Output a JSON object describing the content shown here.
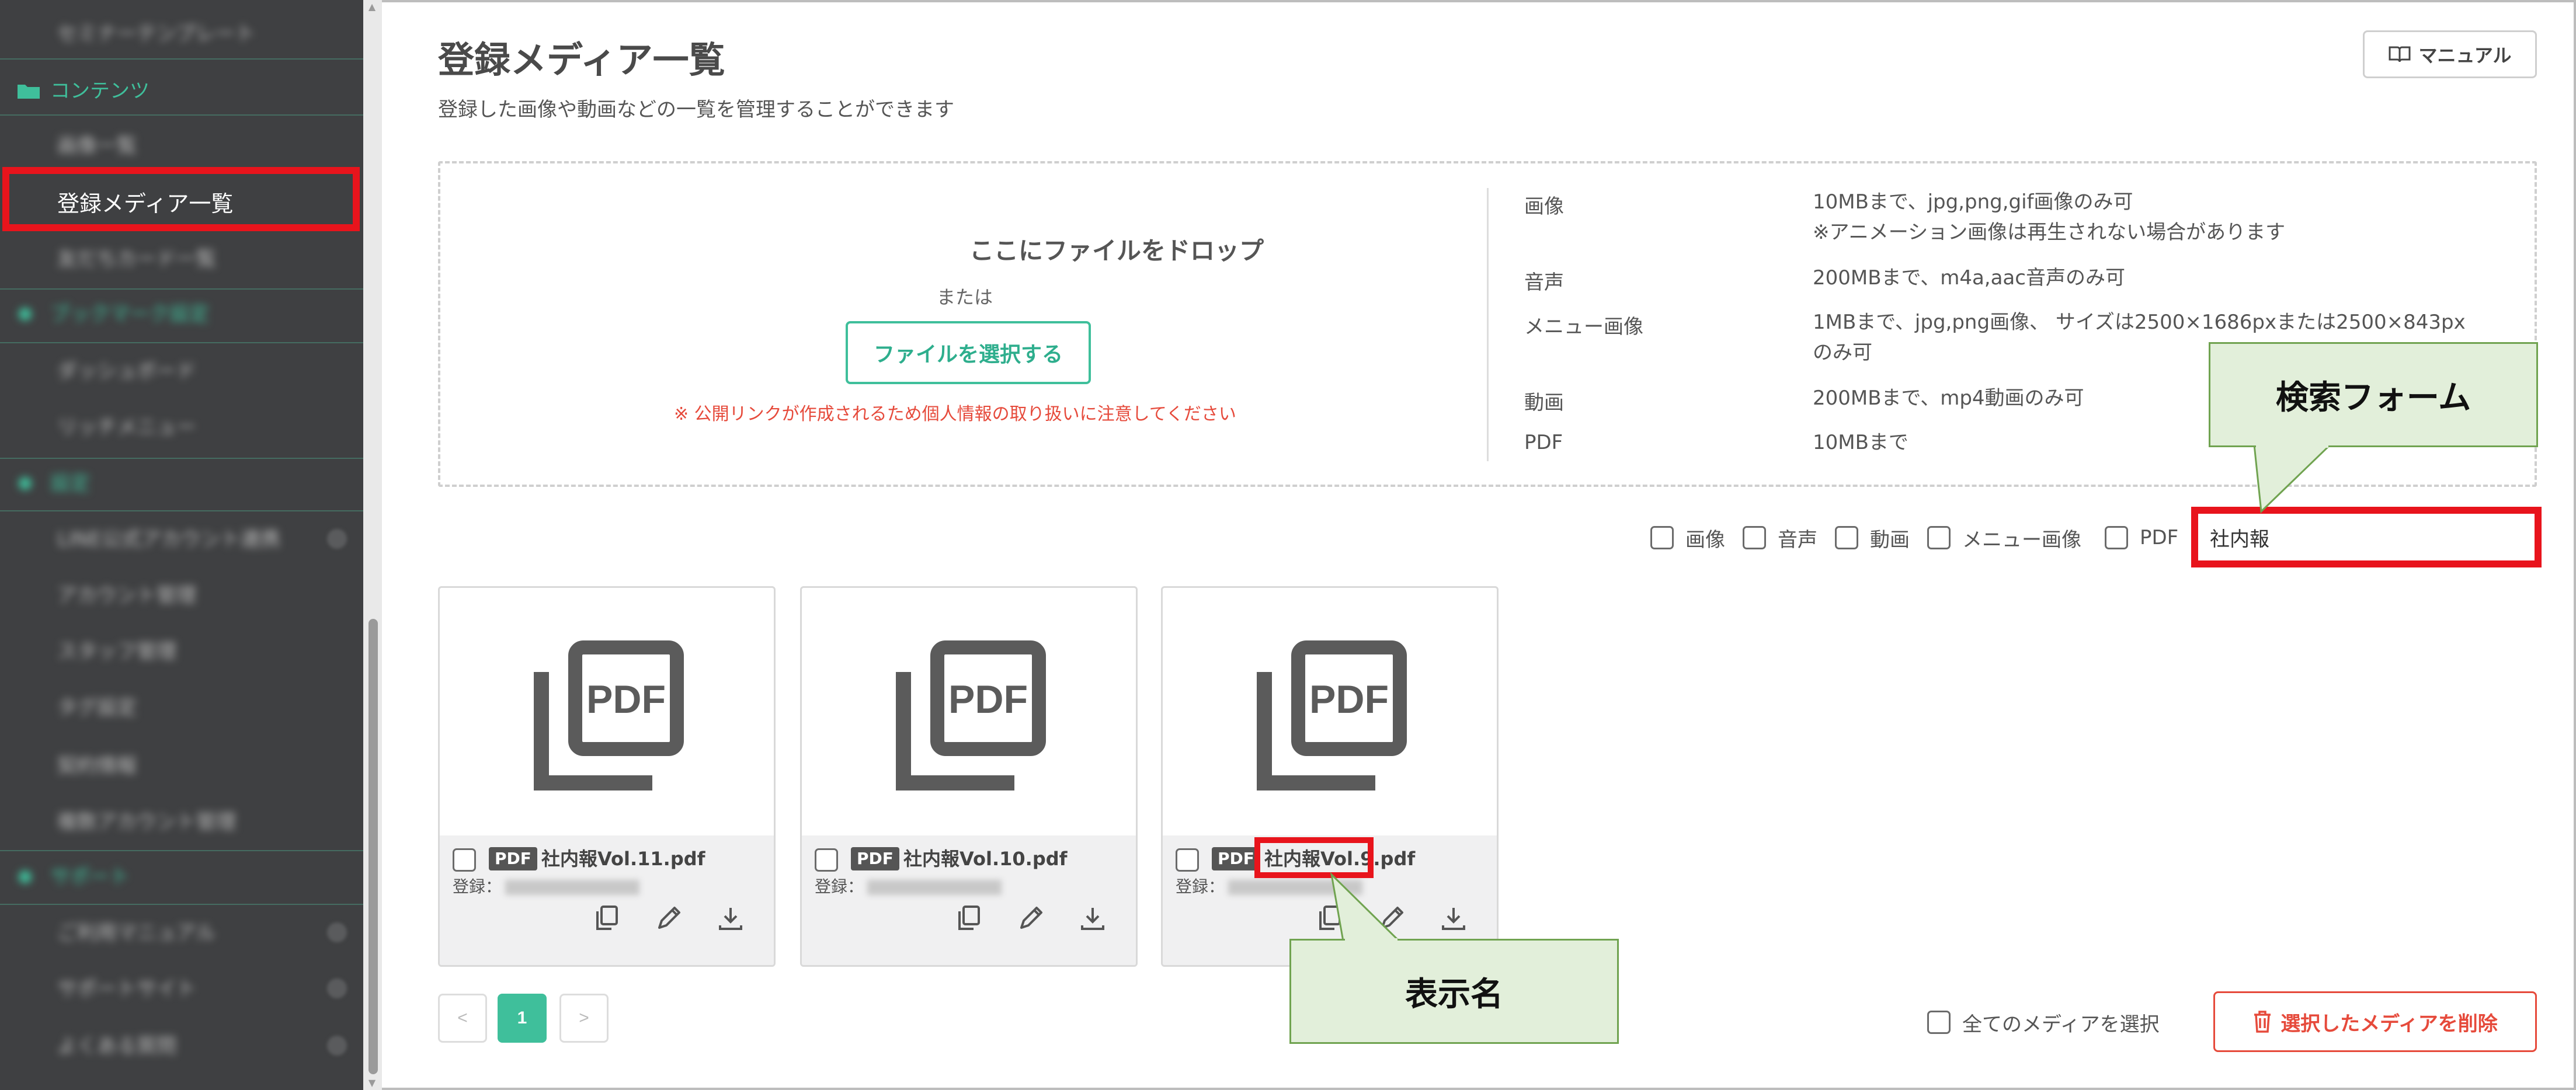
{
  "sidebar": {
    "top_item_blurred": "セミナーテンプレート",
    "section_contents": "コンテンツ",
    "item_blurred_1": "画像一覧",
    "active_item": "登録メディア一覧",
    "item_blurred_2": "友だちカード一覧",
    "section_blurred_1": "ブックマーク設定",
    "item_blurred_3": "ダッシュボード",
    "item_blurred_4": "リッチメニュー",
    "section_blurred_2": "設定",
    "item_blurred_5": "LINE公式アカウント連携",
    "item_blurred_6": "アカウント管理",
    "item_blurred_7": "スタッフ管理",
    "item_blurred_8": "タグ設定",
    "item_blurred_9": "契約情報",
    "item_blurred_10": "複数アカウント管理",
    "section_blurred_3": "サポート",
    "item_blurred_11": "ご利用マニュアル",
    "item_blurred_12": "サポートサイト",
    "item_blurred_13": "よくある質問"
  },
  "header": {
    "title": "登録メディア一覧",
    "subtitle": "登録した画像や動画などの一覧を管理することができます",
    "manual_button": "マニュアル"
  },
  "dropzone": {
    "title": "ここにファイルをドロップ",
    "or": "または",
    "select_button": "ファイルを選択する",
    "warning": "※ 公開リンクが作成されるため個人情報の取り扱いに注意してください",
    "specs": [
      {
        "label": "画像",
        "line1": "10MBまで、jpg,png,gif画像のみ可",
        "line2": "※アニメーション画像は再生されない場合があります"
      },
      {
        "label": "音声",
        "line1": "200MBまで、m4a,aac音声のみ可",
        "line2": ""
      },
      {
        "label": "メニュー画像",
        "line1": "1MBまで、jpg,png画像、 サイズは2500×1686pxまたは2500×843px",
        "line2": "のみ可"
      },
      {
        "label": "動画",
        "line1": "200MBまで、mp4動画のみ可",
        "line2": ""
      },
      {
        "label": "PDF",
        "line1": "10MBまで",
        "line2": ""
      }
    ]
  },
  "filters": {
    "image": "画像",
    "audio": "音声",
    "video": "動画",
    "menu_image": "メニュー画像",
    "pdf": "PDF",
    "search_value": "社内報"
  },
  "media": [
    {
      "tag": "PDF",
      "icon_text": "PDF",
      "name": "社内報Vol.11.pdf",
      "registered_label": "登録："
    },
    {
      "tag": "PDF",
      "icon_text": "PDF",
      "name": "社内報Vol.10.pdf",
      "registered_label": "登録："
    },
    {
      "tag": "PDF",
      "icon_text": "PDF",
      "name": "社内報Vol.9.pdf",
      "registered_label": "登録："
    }
  ],
  "pagination": {
    "prev": "<",
    "current": "1",
    "next": ">"
  },
  "footer": {
    "select_all": "全てのメディアを選択",
    "delete_button": "選択したメディアを削除"
  },
  "callouts": {
    "search_form": "検索フォーム",
    "display_name": "表示名"
  },
  "colors": {
    "accent": "#3fbf9b",
    "danger": "#e64a3b",
    "highlight_red": "#e8141c",
    "callout_fill": "#e2efda",
    "callout_border": "#70a350",
    "sidebar_bg": "#3f4042"
  }
}
